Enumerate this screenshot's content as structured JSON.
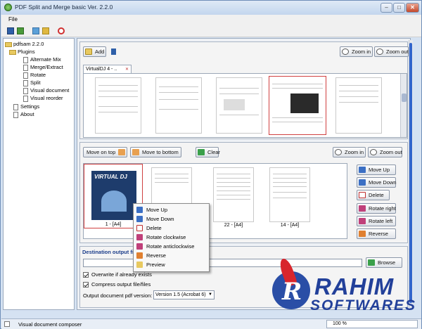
{
  "window": {
    "title": "PDF Split and Merge basic Ver. 2.2.0",
    "controls": [
      "–",
      "□",
      "✕"
    ]
  },
  "menu": {
    "file": "File"
  },
  "tree": {
    "root": "pdfsam 2.2.0",
    "plugins": "Plugins",
    "items": [
      "Alternate Mix",
      "Merge/Extract",
      "Rotate",
      "Split",
      "Visual document",
      "Visual reorder"
    ],
    "settings": "Settings",
    "about": "About"
  },
  "top_panel": {
    "add": "Add",
    "zoom_in": "Zoom in",
    "zoom_out": "Zoom out",
    "tab_label": "VirtualDJ 4 - ..",
    "tab_close": "✕"
  },
  "work_panel": {
    "move_on_top": "Move on top",
    "move_to_bottom": "Move to bottom",
    "clear": "Clear",
    "zoom_in": "Zoom in",
    "zoom_out": "Zoom out",
    "pages": [
      "1 - [A4]",
      "22 - [A4]",
      "14 - [A4]"
    ],
    "cover_text": "VIRTUAL DJ",
    "side_buttons": [
      "Move Up",
      "Move Down",
      "Delete",
      "Rotate right",
      "Rotate left",
      "Reverse"
    ]
  },
  "context_menu": {
    "items": [
      "Move Up",
      "Move Down",
      "Delete",
      "Rotate clockwise",
      "Rotate anticlockwise",
      "Reverse",
      "Preview"
    ]
  },
  "destination": {
    "label": "Destination output file",
    "browse": "Browse",
    "overwrite": "Overwrite if already exists",
    "compress": "Compress output file/files",
    "version_label": "Output document pdf version:",
    "version_value": "Version 1.5 (Acrobat 6)"
  },
  "status": {
    "text": "Visual document composer",
    "progress": "100 %"
  },
  "watermark": {
    "line1": "RAHIM",
    "line2": "SOFTWARES",
    "mark": "R"
  },
  "colors": {
    "accent": "#3399ff",
    "title": "#1a3c8a",
    "watermark_blue": "#22409a",
    "watermark_red": "#d8262c"
  }
}
